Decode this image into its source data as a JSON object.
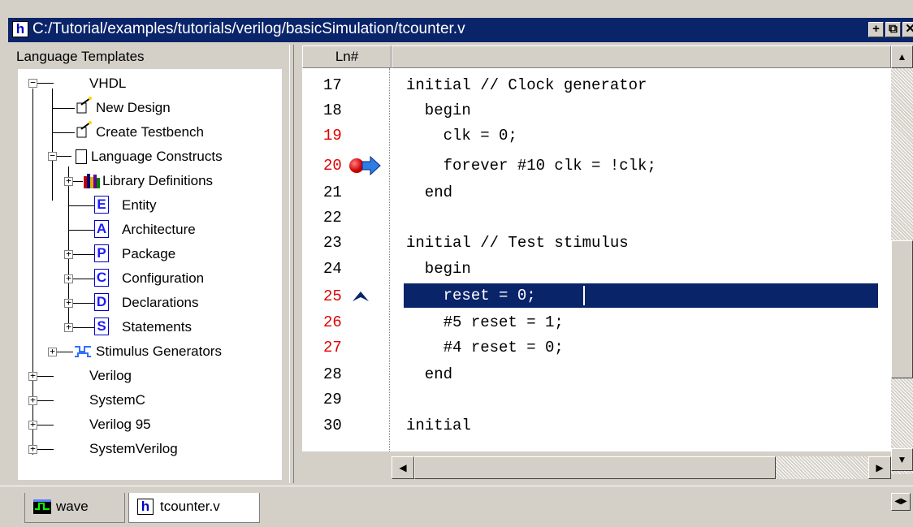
{
  "window": {
    "title": "C:/Tutorial/examples/tutorials/verilog/basicSimulation/tcounter.v",
    "app_icon_letter": "h",
    "controls": [
      "+",
      "⧉",
      "✕"
    ]
  },
  "left_panel": {
    "header": "Language Templates",
    "tree": [
      {
        "label": "VHDL",
        "expanded": true
      },
      {
        "label": "New Design"
      },
      {
        "label": "Create Testbench"
      },
      {
        "label": "Language Constructs",
        "expanded": true
      },
      {
        "label": "Library Definitions",
        "expanded": false
      },
      {
        "label": "Entity",
        "icon_letter": "E"
      },
      {
        "label": "Architecture",
        "icon_letter": "A"
      },
      {
        "label": "Package",
        "icon_letter": "P",
        "expanded": false
      },
      {
        "label": "Configuration",
        "icon_letter": "C",
        "expanded": false
      },
      {
        "label": "Declarations",
        "icon_letter": "D",
        "expanded": false
      },
      {
        "label": "Statements",
        "icon_letter": "S",
        "expanded": false
      },
      {
        "label": "Stimulus Generators",
        "expanded": false
      },
      {
        "label": "Verilog",
        "expanded": false
      },
      {
        "label": "SystemC",
        "expanded": false
      },
      {
        "label": "Verilog 95",
        "expanded": false
      },
      {
        "label": "SystemVerilog",
        "expanded": false
      }
    ]
  },
  "editor": {
    "ln_header": "Ln#",
    "lines": [
      {
        "num": "17",
        "code": "initial // Clock generator",
        "red": false
      },
      {
        "num": "18",
        "code": "  begin",
        "red": false
      },
      {
        "num": "19",
        "code": "    clk = 0;",
        "red": true
      },
      {
        "num": "20",
        "code": "    forever #10 clk = !clk;",
        "red": true
      },
      {
        "num": "21",
        "code": "  end",
        "red": false
      },
      {
        "num": "22",
        "code": "",
        "red": false
      },
      {
        "num": "23",
        "code": "initial // Test stimulus",
        "red": false
      },
      {
        "num": "24",
        "code": "  begin",
        "red": false
      },
      {
        "num": "25",
        "code": "    reset = 0;",
        "red": true
      },
      {
        "num": "26",
        "code": "    #5 reset = 1;",
        "red": true
      },
      {
        "num": "27",
        "code": "    #4 reset = 0;",
        "red": true
      },
      {
        "num": "28",
        "code": "  end",
        "red": false
      },
      {
        "num": "29",
        "code": "",
        "red": false
      },
      {
        "num": "30",
        "code": "initial",
        "red": false
      }
    ],
    "highlighted_line": "25",
    "breakpoint_line": "20",
    "current_exec_line": "20",
    "colors": {
      "line_red": "#e00000",
      "highlight": "#0a246a"
    }
  },
  "tabs": [
    {
      "label": "wave",
      "icon": "wave-window-icon",
      "active": false
    },
    {
      "label": "tcounter.v",
      "icon": "h-file-icon",
      "active": true
    }
  ]
}
